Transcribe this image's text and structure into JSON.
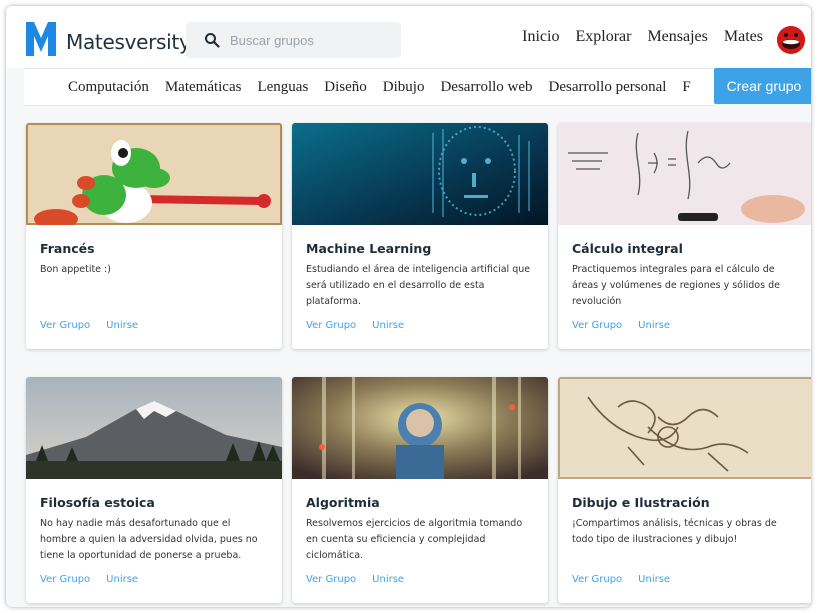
{
  "header": {
    "brand": "Matesversity",
    "search": {
      "placeholder": "Buscar grupos",
      "value": ""
    },
    "nav": [
      "Inicio",
      "Explorar",
      "Mensajes",
      "Mates"
    ]
  },
  "categories": {
    "items": [
      "Computación",
      "Matemáticas",
      "Lenguas",
      "Diseño",
      "Dibujo",
      "Desarrollo web",
      "Desarrollo personal",
      "F"
    ],
    "create_label": "Crear grupo"
  },
  "colors": {
    "accent": "#3da3e6",
    "brand": "#1e88e5",
    "avatar": "#d01a1a"
  },
  "groups": [
    {
      "title": "Francés",
      "description": "Bon appetite :)",
      "view_label": "Ver Grupo",
      "join_label": "Unirse",
      "image": "yoshi-illustration"
    },
    {
      "title": "Machine Learning",
      "description": "Estudiando el área de inteligencia artificial que será utilizado en el desarrollo de esta plataforma.",
      "view_label": "Ver Grupo",
      "join_label": "Unirse",
      "image": "digital-face"
    },
    {
      "title": "Cálculo integral",
      "description": "Practiquemos integrales para el cálculo de áreas y volúmenes de regiones y sólidos de revolución",
      "view_label": "Ver Grupo",
      "join_label": "Unirse",
      "image": "whiteboard-integrals"
    },
    {
      "title": "Filosofía estoica",
      "description": "No hay nadie más desafortunado que el hombre a quien la adversidad olvida, pues no tiene la oportunidad de ponerse a prueba.",
      "view_label": "Ver Grupo",
      "join_label": "Unirse",
      "image": "mountain-landscape"
    },
    {
      "title": "Algoritmia",
      "description": "Resolvemos ejercicios de algoritmia tomando en cuenta su eficiencia y complejidad ciclomática.",
      "view_label": "Ver Grupo",
      "join_label": "Unirse",
      "image": "game-character-art"
    },
    {
      "title": "Dibujo e Ilustración",
      "description": "¡Compartimos análisis, técnicas y obras de todo tipo de ilustraciones y dibujo!",
      "view_label": "Ver Grupo",
      "join_label": "Unirse",
      "image": "sketch-drawing"
    }
  ]
}
